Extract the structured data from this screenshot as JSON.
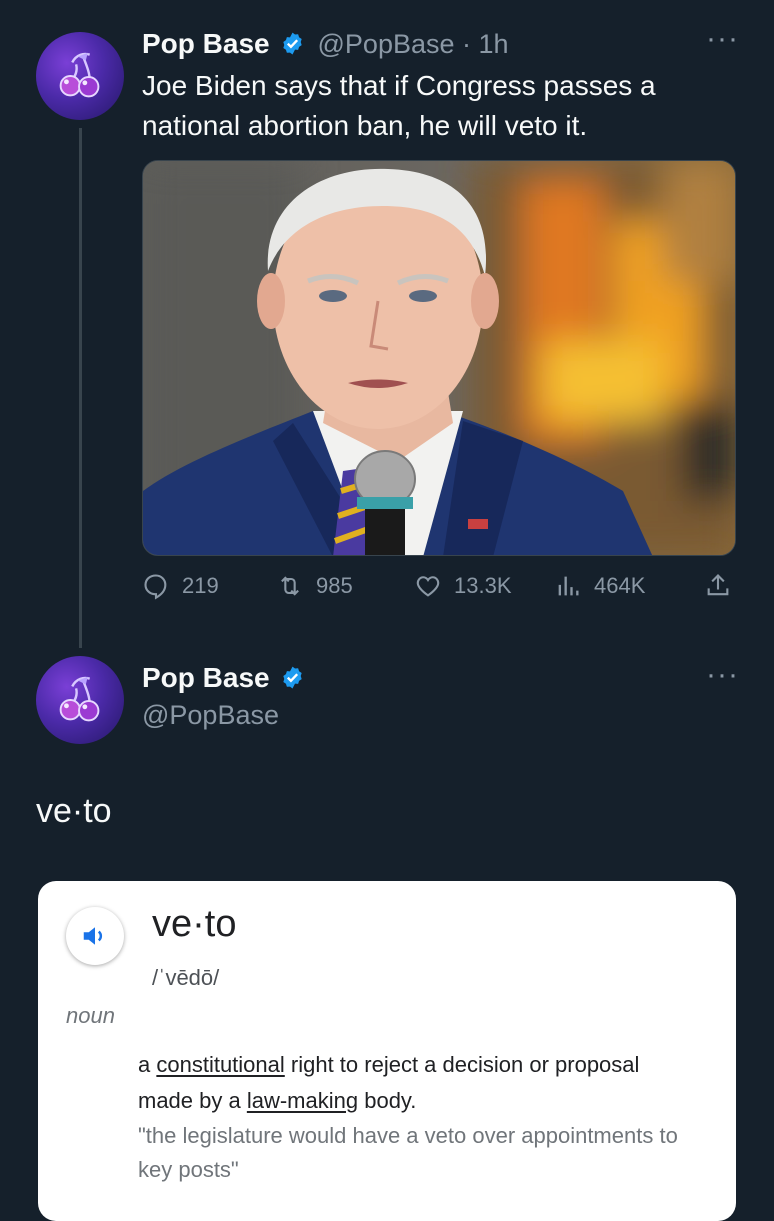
{
  "tweet": {
    "display_name": "Pop Base",
    "handle": "@PopBase",
    "time": " · 1h",
    "text": "Joe Biden says that if Congress passes a national abortion ban, he will veto it.",
    "stats": {
      "replies": "219",
      "retweets": "985",
      "likes": "13.3K",
      "views": "464K"
    }
  },
  "reply": {
    "display_name": "Pop Base",
    "handle": "@PopBase",
    "text": "ve·to"
  },
  "dictionary": {
    "word": "ve·to",
    "phonetic": "/ˈvēdō/",
    "part_of_speech": "noun",
    "def_before": "a ",
    "def_link1": "constitutional",
    "def_middle": " right to reject a decision or proposal made by a ",
    "def_link2": "law-making",
    "def_after": " body.",
    "example": "\"the legislature would have a veto over appointments to key posts\""
  },
  "colors": {
    "background": "#15202b",
    "verified": "#1d9bf0",
    "muted": "#8b98a5"
  }
}
